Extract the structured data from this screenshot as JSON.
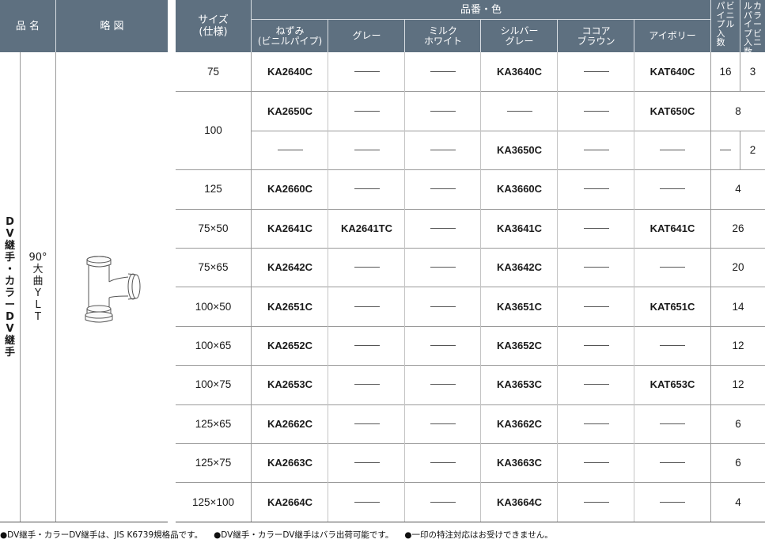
{
  "left_header": {
    "hinmei": "品 名",
    "ryakuzu": "略 図"
  },
  "category": [
    "D",
    "V",
    "継",
    "手",
    "・",
    "カ",
    "ラ",
    "ー",
    "D",
    "V",
    "継",
    "手"
  ],
  "subcategory": [
    "90°",
    "大",
    "曲",
    "Y",
    "L",
    "T"
  ],
  "main_header": {
    "size_line1": "サイズ",
    "size_line2": "(仕様)",
    "hinban_iro": "品番・色",
    "colors": [
      {
        "line1": "ねずみ",
        "line2": "(ビニルパイプ)"
      },
      {
        "line1": "グレー",
        "line2": ""
      },
      {
        "line1": "ミルク",
        "line2": "ホワイト"
      },
      {
        "line1": "シルバー",
        "line2": "グレー"
      },
      {
        "line1": "ココア",
        "line2": "ブラウン"
      },
      {
        "line1": "アイボリー",
        "line2": ""
      }
    ],
    "vinyl_pipe_qty": [
      "ビ",
      "ニ",
      "ル",
      "パ",
      "イ",
      "プ",
      "入",
      "数"
    ],
    "color_vinyl_qty": [
      "カ",
      "ラ",
      "ー",
      "ビ",
      "ニ",
      "ル",
      "パ",
      "イ",
      "プ",
      "入",
      "数"
    ]
  },
  "rows": [
    {
      "size": "75",
      "codes": [
        "KA2640C",
        "—",
        "—",
        "KA3640C",
        "—",
        "KAT640C"
      ],
      "qty": [
        "16",
        "3"
      ]
    },
    {
      "size": "100",
      "codes": [
        "KA2650C",
        "—",
        "—",
        "—",
        "—",
        "KAT650C"
      ],
      "qty": [
        "8"
      ]
    },
    {
      "size": "",
      "codes": [
        "—",
        "—",
        "—",
        "KA3650C",
        "—",
        "—"
      ],
      "qty": [
        "—",
        "2"
      ]
    },
    {
      "size": "125",
      "codes": [
        "KA2660C",
        "—",
        "—",
        "KA3660C",
        "—",
        "—"
      ],
      "qty": [
        "4"
      ]
    },
    {
      "size": "75×50",
      "codes": [
        "KA2641C",
        "KA2641TC",
        "—",
        "KA3641C",
        "—",
        "KAT641C"
      ],
      "qty": [
        "26"
      ]
    },
    {
      "size": "75×65",
      "codes": [
        "KA2642C",
        "—",
        "—",
        "KA3642C",
        "—",
        "—"
      ],
      "qty": [
        "20"
      ]
    },
    {
      "size": "100×50",
      "codes": [
        "KA2651C",
        "—",
        "—",
        "KA3651C",
        "—",
        "KAT651C"
      ],
      "qty": [
        "14"
      ]
    },
    {
      "size": "100×65",
      "codes": [
        "KA2652C",
        "—",
        "—",
        "KA3652C",
        "—",
        "—"
      ],
      "qty": [
        "12"
      ]
    },
    {
      "size": "100×75",
      "codes": [
        "KA2653C",
        "—",
        "—",
        "KA3653C",
        "—",
        "KAT653C"
      ],
      "qty": [
        "12"
      ]
    },
    {
      "size": "125×65",
      "codes": [
        "KA2662C",
        "—",
        "—",
        "KA3662C",
        "—",
        "—"
      ],
      "qty": [
        "6"
      ]
    },
    {
      "size": "125×75",
      "codes": [
        "KA2663C",
        "—",
        "—",
        "KA3663C",
        "—",
        "—"
      ],
      "qty": [
        "6"
      ]
    },
    {
      "size": "125×100",
      "codes": [
        "KA2664C",
        "—",
        "—",
        "KA3664C",
        "—",
        "—"
      ],
      "qty": [
        "4"
      ]
    }
  ],
  "footnotes": [
    "●DV継手・カラーDV継手は、JIS K6739規格品です。",
    "●DV継手・カラーDV継手はバラ出荷可能です。",
    "●一印の特注対応はお受けできません。"
  ],
  "colors": {
    "header_bg": "#5e7080",
    "header_text": "#ffffff",
    "rule": "#8a8a8a"
  },
  "illustration": "pvc-tee-fitting-icon"
}
